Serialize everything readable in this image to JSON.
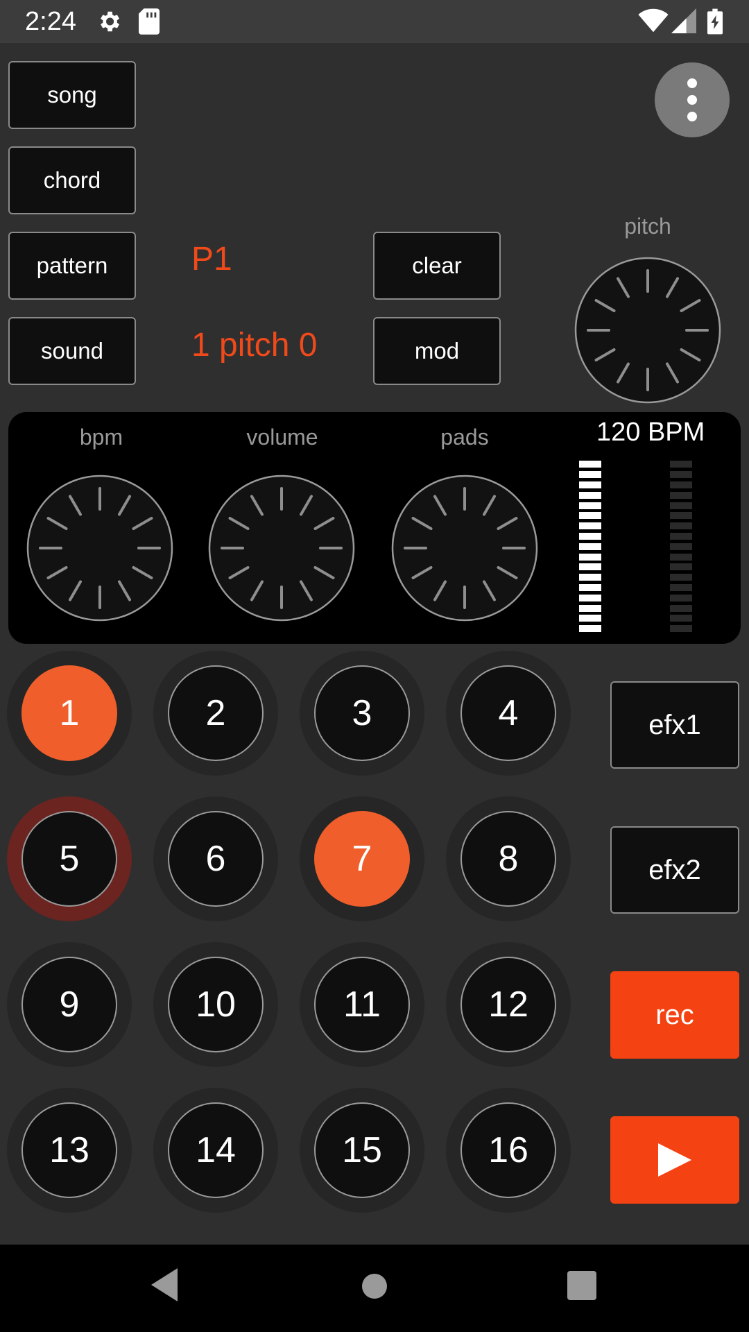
{
  "status_bar": {
    "time": "2:24",
    "icons": [
      "gear-icon",
      "sd-card-icon",
      "wifi-icon",
      "signal-icon",
      "battery-charging-icon"
    ]
  },
  "left_buttons": {
    "song": "song",
    "chord": "chord",
    "pattern": "pattern",
    "sound": "sound"
  },
  "pattern_display": {
    "pattern_name": "P1",
    "sound_info": "1 pitch 0"
  },
  "action_buttons": {
    "clear": "clear",
    "mod": "mod"
  },
  "knobs": {
    "pitch": "pitch",
    "bpm": "bpm",
    "volume": "volume",
    "pads": "pads"
  },
  "tempo_display": "120 BPM",
  "meters": {
    "left_level": 1.0,
    "right_level": 0.0,
    "segments": 17
  },
  "pads": [
    {
      "label": "1",
      "active": true,
      "playing": false
    },
    {
      "label": "2",
      "active": false,
      "playing": false
    },
    {
      "label": "3",
      "active": false,
      "playing": false
    },
    {
      "label": "4",
      "active": false,
      "playing": false
    },
    {
      "label": "5",
      "active": false,
      "playing": true
    },
    {
      "label": "6",
      "active": false,
      "playing": false
    },
    {
      "label": "7",
      "active": true,
      "playing": false
    },
    {
      "label": "8",
      "active": false,
      "playing": false
    },
    {
      "label": "9",
      "active": false,
      "playing": false
    },
    {
      "label": "10",
      "active": false,
      "playing": false
    },
    {
      "label": "11",
      "active": false,
      "playing": false
    },
    {
      "label": "12",
      "active": false,
      "playing": false
    },
    {
      "label": "13",
      "active": false,
      "playing": false
    },
    {
      "label": "14",
      "active": false,
      "playing": false
    },
    {
      "label": "15",
      "active": false,
      "playing": false
    },
    {
      "label": "16",
      "active": false,
      "playing": false
    }
  ],
  "side_buttons": {
    "efx1": "efx1",
    "efx2": "efx2",
    "rec": "rec",
    "play_icon": "play-icon"
  },
  "colors": {
    "accent": "#f54212",
    "pad_active": "#f05f2b",
    "pad_playing_ring": "#6b2420",
    "background": "#2f2f30"
  },
  "nav_bar": {
    "icons": [
      "back-icon",
      "home-icon",
      "recents-icon"
    ]
  }
}
